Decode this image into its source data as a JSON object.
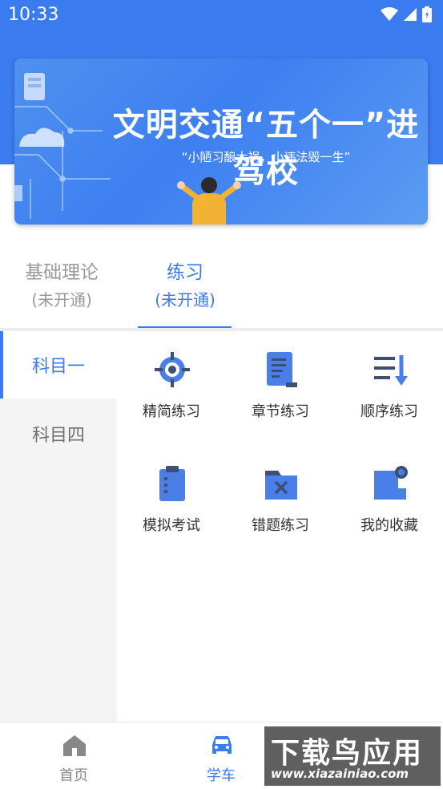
{
  "status_bar": {
    "time": "10:33"
  },
  "banner": {
    "title": "文明交通“五个一”进驾校",
    "subtitle": "“小陋习酿大祸，小违法毁一生”"
  },
  "tabs": [
    {
      "label": "基础理论",
      "sub": "(未开通)",
      "active": false
    },
    {
      "label": "练习",
      "sub": "(未开通)",
      "active": true
    }
  ],
  "sidebar": {
    "items": [
      {
        "label": "科目一",
        "active": true
      },
      {
        "label": "科目四",
        "active": false
      }
    ]
  },
  "practice_grid": {
    "items": [
      {
        "label": "精简练习",
        "icon": "target-icon"
      },
      {
        "label": "章节练习",
        "icon": "document-list-icon"
      },
      {
        "label": "顺序练习",
        "icon": "sort-down-icon"
      },
      {
        "label": "模拟考试",
        "icon": "clipboard-icon"
      },
      {
        "label": "错题练习",
        "icon": "folder-x-icon"
      },
      {
        "label": "我的收藏",
        "icon": "bookmark-pin-icon"
      }
    ]
  },
  "bottom_nav": {
    "items": [
      {
        "label": "首页",
        "icon": "home-icon",
        "active": false
      },
      {
        "label": "学车",
        "icon": "car-icon",
        "active": true
      }
    ]
  },
  "watermark": {
    "brand": "下载鸟应用",
    "url": "www.xiazainiao.com"
  },
  "colors": {
    "accent": "#3a7bef",
    "icon_blue": "#4a7fe8",
    "icon_dark": "#3d4f74",
    "inactive_text": "#9a9a9a",
    "sidebar_bg": "#f4f4f4"
  }
}
